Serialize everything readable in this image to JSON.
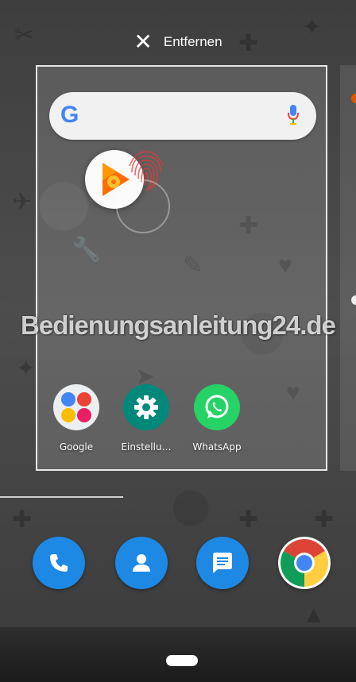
{
  "remove_bar": {
    "icon": "close-icon",
    "label": "Entfernen"
  },
  "search": {
    "logo_letter": "G",
    "logo_icon": "google-g-icon",
    "mic_icon": "mic-icon"
  },
  "dragged_app": {
    "icon": "play-music-icon",
    "overlay_icon": "fingerprint-icon"
  },
  "watermark": "Bedienungsanleitung24.de",
  "apps": [
    {
      "label": "Google",
      "icon": "google-folder-icon"
    },
    {
      "label": "Einstellu…",
      "icon": "settings-icon",
      "color": "#00897b"
    },
    {
      "label": "WhatsApp",
      "icon": "whatsapp-icon",
      "color": "#25d366"
    }
  ],
  "dock": [
    {
      "icon": "phone-icon",
      "color": "#1e88e5"
    },
    {
      "icon": "contacts-icon",
      "color": "#1e88e5"
    },
    {
      "icon": "messages-icon",
      "color": "#1e88e5"
    },
    {
      "icon": "chrome-icon"
    }
  ],
  "colors": {
    "google_blue": "#4285f4",
    "google_red": "#ea4335",
    "google_yellow": "#fbbc05",
    "google_green": "#34a853"
  }
}
